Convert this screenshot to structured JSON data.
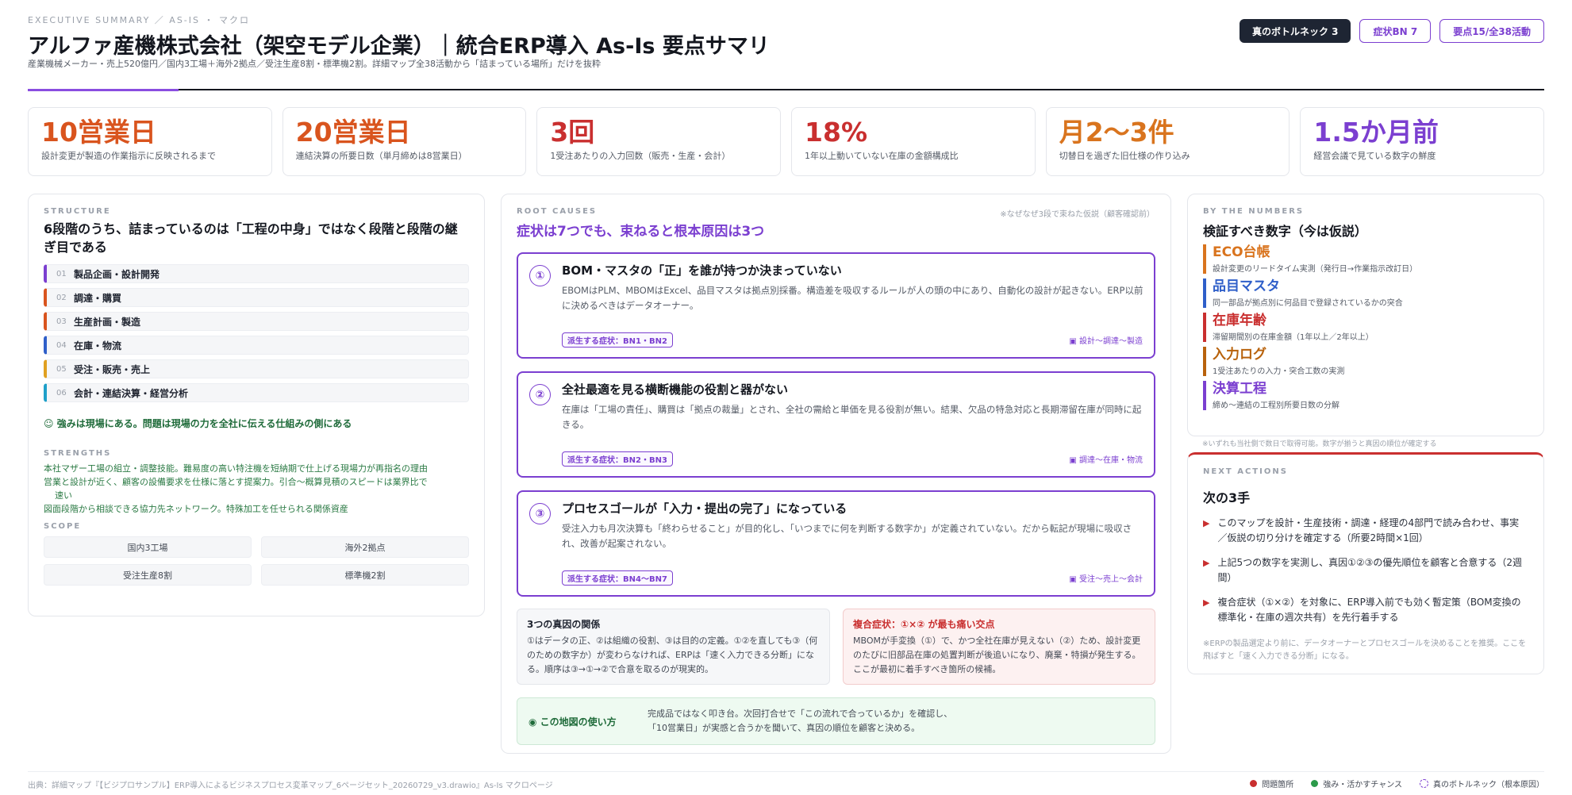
{
  "header": {
    "eyebrow": "EXECUTIVE SUMMARY ／ AS-IS ・ マクロ",
    "title": "アルファ産機株式会社（架空モデル企業）｜統合ERP導入 As-Is 要点サマリ",
    "subtitle": "産業機械メーカー・売上520億円／国内3工場＋海外2拠点／受注生産8割・標準機2割。詳細マップ全38活動から「詰まっている場所」だけを抜粋",
    "badges": [
      "真のボトルネック 3",
      "症状BN 7",
      "要点15/全38活動"
    ]
  },
  "kpis": [
    {
      "value": "10営業日",
      "label": "設計変更が製造の作業指示に反映されるまで",
      "color": "#d9541e"
    },
    {
      "value": "20営業日",
      "label": "連結決算の所要日数（単月締めは8営業日）",
      "color": "#d9541e"
    },
    {
      "value": "3回",
      "label": "1受注あたりの入力回数（販売・生産・会計）",
      "color": "#c92f2f"
    },
    {
      "value": "18%",
      "label": "1年以上動いていない在庫の金額構成比",
      "color": "#c92f2f"
    },
    {
      "value": "月2〜3件",
      "label": "切替日を過ぎた旧仕様の作り込み",
      "color": "#d9741e"
    },
    {
      "value": "1.5か月前",
      "label": "経営会議で見ている数字の鮮度",
      "color": "#7b3fd0"
    }
  ],
  "structure": {
    "label": "STRUCTURE",
    "heading": "6段階のうち、詰まっているのは「工程の中身」ではなく段階と段階の継ぎ目である",
    "stages": [
      {
        "num": "01",
        "name": "製品企画・設計開発",
        "color": "#7b3fd0"
      },
      {
        "num": "02",
        "name": "調達・購買",
        "color": "#d9541e"
      },
      {
        "num": "03",
        "name": "生産計画・製造",
        "color": "#d9541e"
      },
      {
        "num": "04",
        "name": "在庫・物流",
        "color": "#2f5fc9"
      },
      {
        "num": "05",
        "name": "受注・販売・売上",
        "color": "#e0a020"
      },
      {
        "num": "06",
        "name": "会計・連結決算・経営分析",
        "color": "#1fa0c9"
      }
    ],
    "strength_head": "☺ 強みは現場にある。問題は現場の力を全社に伝える仕組みの側にある",
    "strengths_label": "STRENGTHS",
    "strengths": [
      "本社マザー工場の組立・調整技能。難易度の高い特注機を短納期で仕上げる現場力が再指名の理由",
      "営業と設計が近く、顧客の設備要求を仕様に落とす提案力。引合〜概算見積のスピードは業界比で",
      "速い",
      "図面段階から相談できる協力先ネットワーク。特殊加工を任せられる関係資産"
    ],
    "scope_label": "SCOPE",
    "scope": [
      "国内3工場",
      "海外2拠点",
      "受注生産8割",
      "標準機2割"
    ]
  },
  "root": {
    "label": "ROOT CAUSES",
    "note": "※なぜなぜ3段で束ねた仮説（顧客確認前）",
    "heading": "症状は7つでも、束ねると根本原因は3つ",
    "causes": [
      {
        "num": "①",
        "title": "BOM・マスタの「正」を誰が持つか決まっていない",
        "desc": "EBOMはPLM、MBOMはExcel、品目マスタは拠点別採番。構造差を吸収するルールが人の頭の中にあり、自動化の設計が起きない。ERP以前に決めるべきはデータオーナー。",
        "tag": "派生する症状：BN1・BN2",
        "flow": "▣ 設計〜調達〜製造"
      },
      {
        "num": "②",
        "title": "全社最適を見る横断機能の役割と器がない",
        "desc": "在庫は「工場の責任」、購買は「拠点の裁量」とされ、全社の需給と単価を見る役割が無い。結果、欠品の特急対応と長期滞留在庫が同時に起きる。",
        "tag": "派生する症状：BN2・BN3",
        "flow": "▣ 調達〜在庫・物流"
      },
      {
        "num": "③",
        "title": "プロセスゴールが「入力・提出の完了」になっている",
        "desc": "受注入力も月次決算も「終わらせること」が目的化し、「いつまでに何を判断する数字か」が定義されていない。だから転記が現場に吸収され、改善が起案されない。",
        "tag": "派生する症状：BN4〜BN7",
        "flow": "▣ 受注〜売上〜会計"
      }
    ],
    "relation_title": "3つの真因の関係",
    "relation_desc": "①はデータの正、②は組織の役割、③は目的の定義。①②を直しても③（何のための数字か）が変わらなければ、ERPは「速く入力できる分断」になる。順序は③→①→②で合意を取るのが現実的。",
    "compound_title": "複合症状：①×② が最も痛い交点",
    "compound_desc": "MBOMが手変換（①）で、かつ全社在庫が見えない（②）ため、設計変更のたびに旧部品在庫の処置判断が後追いになり、廃棄・特損が発生する。ここが最初に着手すべき箇所の候補。",
    "usage_title": "◉ この地図の使い方",
    "usage_desc1": "完成品ではなく叩き台。次回打合せで「この流れで合っているか」を確認し、",
    "usage_desc2": "「10営業日」が実感と合うかを聞いて、真因の順位を顧客と決める。"
  },
  "numbers": {
    "label": "BY THE NUMBERS",
    "heading": "検証すべき数字（今は仮説）",
    "metrics": [
      {
        "name": "ECO台帳",
        "desc": "設計変更のリードタイム実測（発行日→作業指示改訂日）",
        "color": "#d9741e"
      },
      {
        "name": "品目マスタ",
        "desc": "同一部品が拠点別に何品目で登録されているかの突合",
        "color": "#2f5fc9"
      },
      {
        "name": "在庫年齢",
        "desc": "滞留期間別の在庫金額（1年以上／2年以上）",
        "color": "#c92f2f"
      },
      {
        "name": "入力ログ",
        "desc": "1受注あたりの入力・突合工数の実測",
        "color": "#b8620c"
      },
      {
        "name": "決算工程",
        "desc": "締め〜連結の工程別所要日数の分解",
        "color": "#7b3fd0"
      }
    ],
    "foot": "※いずれも当社側で数日で取得可能。数字が揃うと真因の順位が確定する"
  },
  "actions": {
    "label": "NEXT ACTIONS",
    "heading": "次の3手",
    "items": [
      "このマップを設計・生産技術・調達・経理の4部門で読み合わせ、事実／仮説の切り分けを確定する（所要2時間×1回）",
      "上記5つの数字を実測し、真因①②③の優先順位を顧客と合意する（2週間）",
      "複合症状（①×②）を対象に、ERP導入前でも効く暫定策（BOM変換の標準化・在庫の週次共有）を先行着手する"
    ],
    "foot": "※ERPの製品選定より前に、データオーナーとプロセスゴールを決めることを推奨。ここを飛ばすと「速く入力できる分断」になる。"
  },
  "footer": {
    "source": "出典：詳細マップ『【ビジプロサンプル】ERP導入によるビジネスプロセス変革マップ_6ページセット_20260729_v3.drawio』As-Is マクロページ",
    "legend": [
      "問題箇所",
      "強み・活かすチャンス",
      "真のボトルネック（根本原因）"
    ],
    "legend_colors": [
      "#c92f2f",
      "#2b9a4a",
      "#7b3fd0"
    ]
  }
}
